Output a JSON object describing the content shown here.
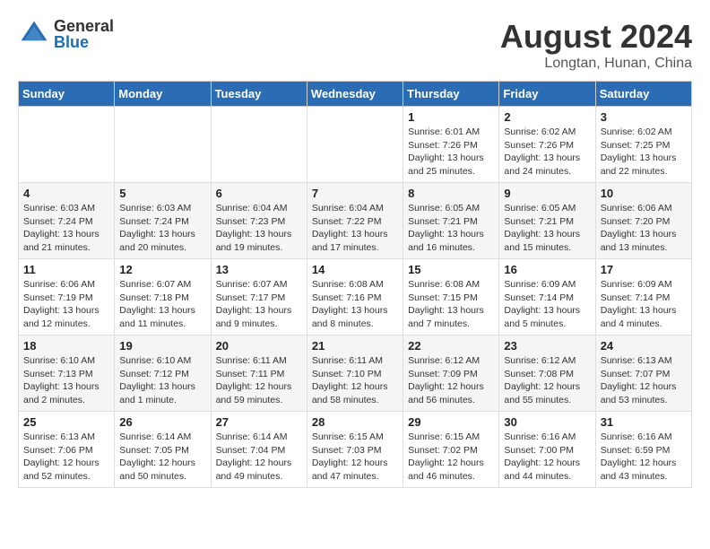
{
  "logo": {
    "general": "General",
    "blue": "Blue"
  },
  "title": "August 2024",
  "location": "Longtan, Hunan, China",
  "weekdays": [
    "Sunday",
    "Monday",
    "Tuesday",
    "Wednesday",
    "Thursday",
    "Friday",
    "Saturday"
  ],
  "weeks": [
    [
      {
        "day": "",
        "info": ""
      },
      {
        "day": "",
        "info": ""
      },
      {
        "day": "",
        "info": ""
      },
      {
        "day": "",
        "info": ""
      },
      {
        "day": "1",
        "info": "Sunrise: 6:01 AM\nSunset: 7:26 PM\nDaylight: 13 hours\nand 25 minutes."
      },
      {
        "day": "2",
        "info": "Sunrise: 6:02 AM\nSunset: 7:26 PM\nDaylight: 13 hours\nand 24 minutes."
      },
      {
        "day": "3",
        "info": "Sunrise: 6:02 AM\nSunset: 7:25 PM\nDaylight: 13 hours\nand 22 minutes."
      }
    ],
    [
      {
        "day": "4",
        "info": "Sunrise: 6:03 AM\nSunset: 7:24 PM\nDaylight: 13 hours\nand 21 minutes."
      },
      {
        "day": "5",
        "info": "Sunrise: 6:03 AM\nSunset: 7:24 PM\nDaylight: 13 hours\nand 20 minutes."
      },
      {
        "day": "6",
        "info": "Sunrise: 6:04 AM\nSunset: 7:23 PM\nDaylight: 13 hours\nand 19 minutes."
      },
      {
        "day": "7",
        "info": "Sunrise: 6:04 AM\nSunset: 7:22 PM\nDaylight: 13 hours\nand 17 minutes."
      },
      {
        "day": "8",
        "info": "Sunrise: 6:05 AM\nSunset: 7:21 PM\nDaylight: 13 hours\nand 16 minutes."
      },
      {
        "day": "9",
        "info": "Sunrise: 6:05 AM\nSunset: 7:21 PM\nDaylight: 13 hours\nand 15 minutes."
      },
      {
        "day": "10",
        "info": "Sunrise: 6:06 AM\nSunset: 7:20 PM\nDaylight: 13 hours\nand 13 minutes."
      }
    ],
    [
      {
        "day": "11",
        "info": "Sunrise: 6:06 AM\nSunset: 7:19 PM\nDaylight: 13 hours\nand 12 minutes."
      },
      {
        "day": "12",
        "info": "Sunrise: 6:07 AM\nSunset: 7:18 PM\nDaylight: 13 hours\nand 11 minutes."
      },
      {
        "day": "13",
        "info": "Sunrise: 6:07 AM\nSunset: 7:17 PM\nDaylight: 13 hours\nand 9 minutes."
      },
      {
        "day": "14",
        "info": "Sunrise: 6:08 AM\nSunset: 7:16 PM\nDaylight: 13 hours\nand 8 minutes."
      },
      {
        "day": "15",
        "info": "Sunrise: 6:08 AM\nSunset: 7:15 PM\nDaylight: 13 hours\nand 7 minutes."
      },
      {
        "day": "16",
        "info": "Sunrise: 6:09 AM\nSunset: 7:14 PM\nDaylight: 13 hours\nand 5 minutes."
      },
      {
        "day": "17",
        "info": "Sunrise: 6:09 AM\nSunset: 7:14 PM\nDaylight: 13 hours\nand 4 minutes."
      }
    ],
    [
      {
        "day": "18",
        "info": "Sunrise: 6:10 AM\nSunset: 7:13 PM\nDaylight: 13 hours\nand 2 minutes."
      },
      {
        "day": "19",
        "info": "Sunrise: 6:10 AM\nSunset: 7:12 PM\nDaylight: 13 hours\nand 1 minute."
      },
      {
        "day": "20",
        "info": "Sunrise: 6:11 AM\nSunset: 7:11 PM\nDaylight: 12 hours\nand 59 minutes."
      },
      {
        "day": "21",
        "info": "Sunrise: 6:11 AM\nSunset: 7:10 PM\nDaylight: 12 hours\nand 58 minutes."
      },
      {
        "day": "22",
        "info": "Sunrise: 6:12 AM\nSunset: 7:09 PM\nDaylight: 12 hours\nand 56 minutes."
      },
      {
        "day": "23",
        "info": "Sunrise: 6:12 AM\nSunset: 7:08 PM\nDaylight: 12 hours\nand 55 minutes."
      },
      {
        "day": "24",
        "info": "Sunrise: 6:13 AM\nSunset: 7:07 PM\nDaylight: 12 hours\nand 53 minutes."
      }
    ],
    [
      {
        "day": "25",
        "info": "Sunrise: 6:13 AM\nSunset: 7:06 PM\nDaylight: 12 hours\nand 52 minutes."
      },
      {
        "day": "26",
        "info": "Sunrise: 6:14 AM\nSunset: 7:05 PM\nDaylight: 12 hours\nand 50 minutes."
      },
      {
        "day": "27",
        "info": "Sunrise: 6:14 AM\nSunset: 7:04 PM\nDaylight: 12 hours\nand 49 minutes."
      },
      {
        "day": "28",
        "info": "Sunrise: 6:15 AM\nSunset: 7:03 PM\nDaylight: 12 hours\nand 47 minutes."
      },
      {
        "day": "29",
        "info": "Sunrise: 6:15 AM\nSunset: 7:02 PM\nDaylight: 12 hours\nand 46 minutes."
      },
      {
        "day": "30",
        "info": "Sunrise: 6:16 AM\nSunset: 7:00 PM\nDaylight: 12 hours\nand 44 minutes."
      },
      {
        "day": "31",
        "info": "Sunrise: 6:16 AM\nSunset: 6:59 PM\nDaylight: 12 hours\nand 43 minutes."
      }
    ]
  ]
}
